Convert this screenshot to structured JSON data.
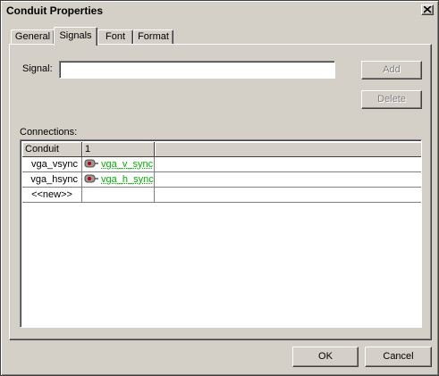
{
  "window": {
    "title": "Conduit Properties"
  },
  "tabs": [
    {
      "label": "General"
    },
    {
      "label": "Signals",
      "active": true
    },
    {
      "label": "Font"
    },
    {
      "label": "Format"
    }
  ],
  "signal": {
    "label": "Signal:",
    "value": "",
    "add_label": "Add",
    "delete_label": "Delete"
  },
  "connections": {
    "label": "Connections:",
    "columns": [
      "Conduit",
      "1",
      ""
    ],
    "rows": [
      {
        "conduit": "vga_vsync",
        "signal": "vga_v_sync",
        "icon": "signal-connector-icon"
      },
      {
        "conduit": "vga_hsync",
        "signal": "vga_h_sync",
        "icon": "signal-connector-icon"
      },
      {
        "conduit": "<<new>>",
        "signal": ""
      }
    ]
  },
  "footer": {
    "ok_label": "OK",
    "cancel_label": "Cancel"
  },
  "colors": {
    "face": "#d4d0c8",
    "signal_text": "#00b000"
  }
}
